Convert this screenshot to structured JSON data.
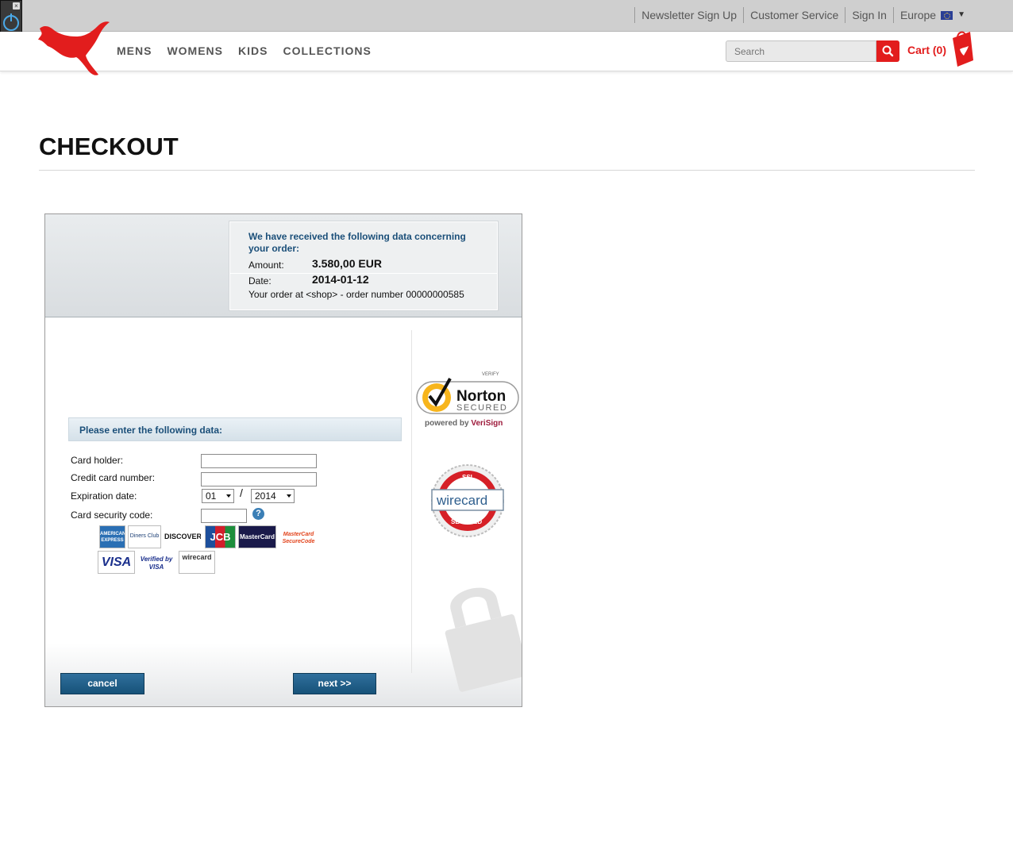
{
  "top_links": [
    "Newsletter Sign Up",
    "Customer Service",
    "Sign In"
  ],
  "region": "Europe",
  "main_nav": [
    "MENS",
    "WOMENS",
    "KIDS",
    "COLLECTIONS"
  ],
  "search": {
    "placeholder": "Search"
  },
  "cart_label": "Cart (0)",
  "page_title": "CHECKOUT",
  "order_summary": {
    "heading": "We have received the following data concerning your order:",
    "amount_label": "Amount:",
    "amount_value": "3.580,00  EUR",
    "date_label": "Date:",
    "date_value": "2014-01-12",
    "order_line": "Your order at <shop> - order number 00000000585"
  },
  "form": {
    "heading": "Please enter the following data:",
    "card_holder_label": "Card holder:",
    "card_number_label": "Credit card number:",
    "expiration_label": "Expiration date:",
    "exp_month": "01",
    "exp_year": "2014",
    "separator": "/",
    "security_code_label": "Card security code:",
    "help_symbol": "?"
  },
  "card_logos": [
    "AMERICAN EXPRESS",
    "Diners Club",
    "DISCOVER",
    "JCB",
    "MasterCard",
    "MasterCard SecureCode",
    "VISA",
    "Verified by VISA",
    "wirecard"
  ],
  "badges": {
    "norton_verify": "VERIFY",
    "norton_name": "Norton",
    "norton_secured": "SECURED",
    "norton_powered_prefix": "powered by ",
    "norton_powered_brand": "VeriSign",
    "wirecard_ssl": "SSL",
    "wirecard_name": "wirecard",
    "wirecard_secured": "SECURED"
  },
  "buttons": {
    "cancel": "cancel",
    "next": "next >>"
  },
  "colors": {
    "brand_red": "#e21d1d",
    "frame_blue": "#1b4f79",
    "button_blue": "#175279"
  }
}
